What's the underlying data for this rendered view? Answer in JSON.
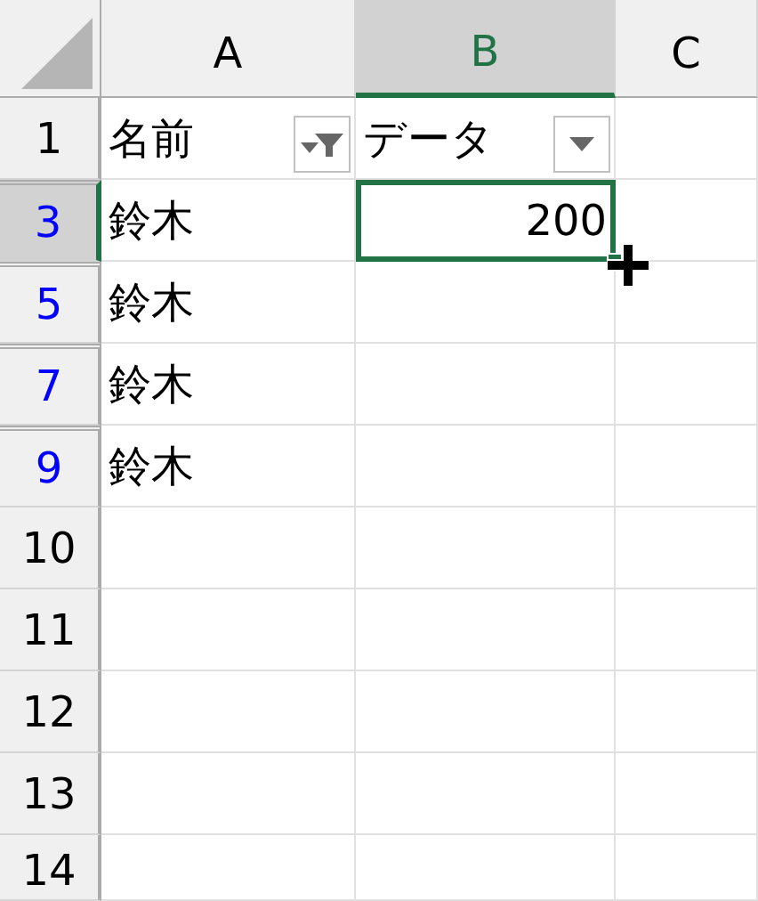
{
  "columns": [
    {
      "label": "A",
      "selected": false
    },
    {
      "label": "B",
      "selected": true
    },
    {
      "label": "C",
      "selected": false
    }
  ],
  "rows": [
    {
      "number": "1",
      "filtered": false,
      "selected": false,
      "cells": [
        {
          "text": "名前",
          "kind": "text",
          "filter_button": {
            "filtered": true
          },
          "selected": false
        },
        {
          "text": "データ",
          "kind": "text",
          "filter_button": {
            "filtered": false
          },
          "selected": false
        },
        {
          "selected": false
        }
      ]
    },
    {
      "number": "3",
      "filtered": true,
      "selected": true,
      "cells": [
        {
          "text": "鈴木",
          "kind": "text",
          "selected": false
        },
        {
          "text": "200",
          "kind": "number",
          "selected": true
        },
        {
          "selected": false
        }
      ]
    },
    {
      "number": "5",
      "filtered": true,
      "selected": false,
      "cells": [
        {
          "text": "鈴木",
          "kind": "text",
          "selected": false
        },
        {
          "selected": false
        },
        {
          "selected": false
        }
      ]
    },
    {
      "number": "7",
      "filtered": true,
      "selected": false,
      "cells": [
        {
          "text": "鈴木",
          "kind": "text",
          "selected": false
        },
        {
          "selected": false
        },
        {
          "selected": false
        }
      ]
    },
    {
      "number": "9",
      "filtered": true,
      "selected": false,
      "cells": [
        {
          "text": "鈴木",
          "kind": "text",
          "selected": false
        },
        {
          "selected": false
        },
        {
          "selected": false
        }
      ]
    },
    {
      "number": "10",
      "filtered": false,
      "selected": false,
      "cells": [
        {
          "selected": false
        },
        {
          "selected": false
        },
        {
          "selected": false
        }
      ]
    },
    {
      "number": "11",
      "filtered": false,
      "selected": false,
      "cells": [
        {
          "selected": false
        },
        {
          "selected": false
        },
        {
          "selected": false
        }
      ]
    },
    {
      "number": "12",
      "filtered": false,
      "selected": false,
      "cells": [
        {
          "selected": false
        },
        {
          "selected": false
        },
        {
          "selected": false
        }
      ]
    },
    {
      "number": "13",
      "filtered": false,
      "selected": false,
      "cells": [
        {
          "selected": false
        },
        {
          "selected": false
        },
        {
          "selected": false
        }
      ]
    },
    {
      "number": "14",
      "filtered": false,
      "selected": false,
      "cells": [
        {
          "selected": false
        },
        {
          "selected": false
        },
        {
          "selected": false
        }
      ]
    }
  ]
}
